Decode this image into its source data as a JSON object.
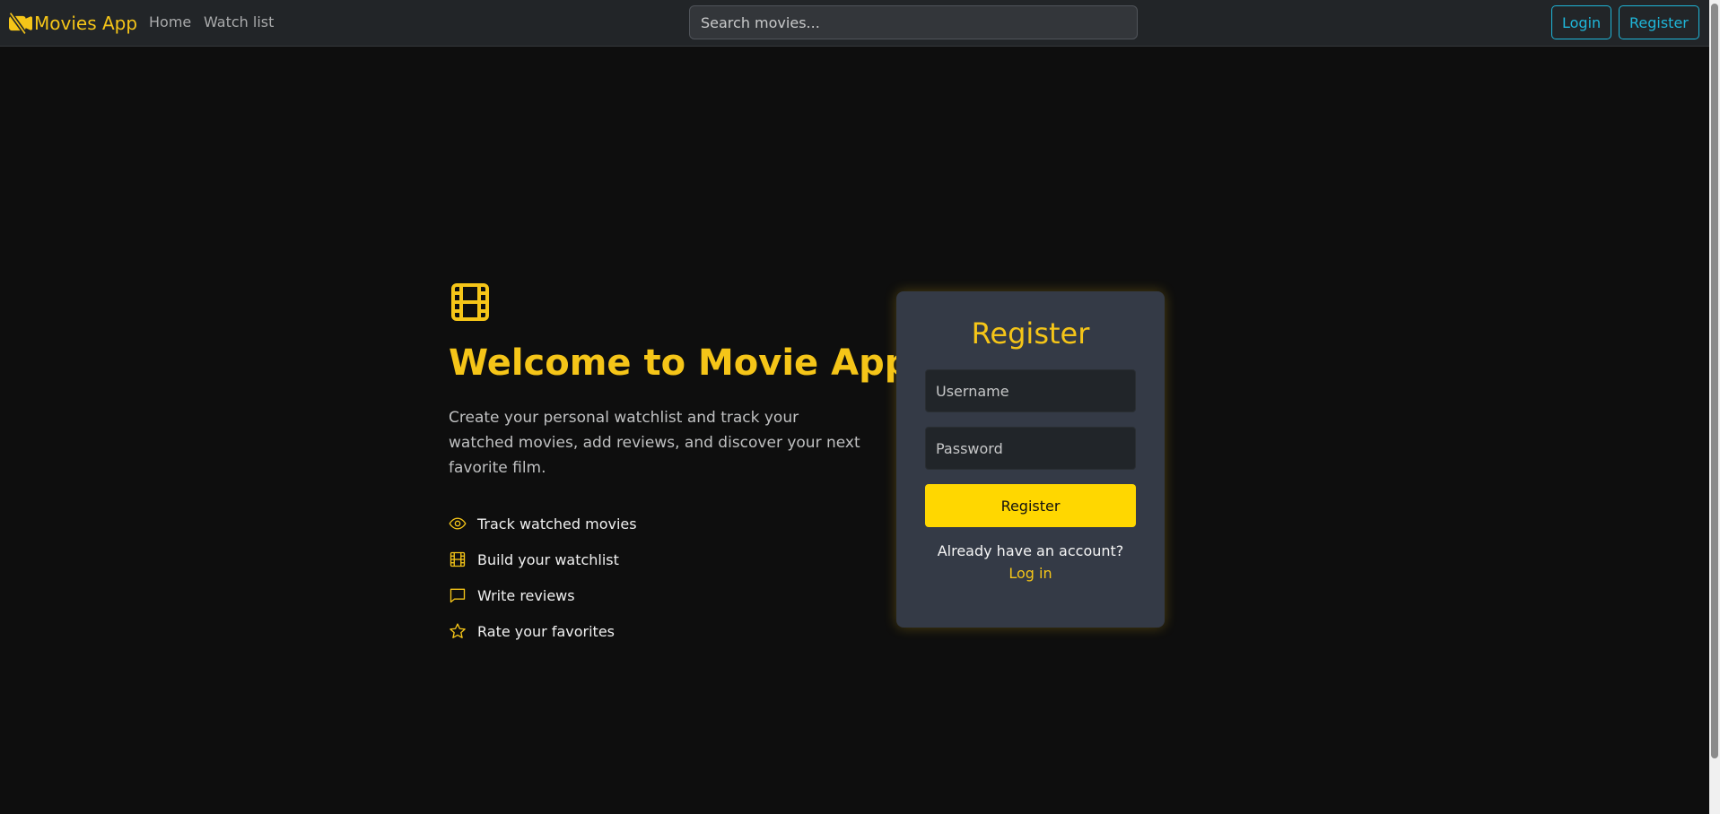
{
  "colors": {
    "accent": "#f5c518",
    "button_yellow": "#ffd700",
    "outline_cyan": "#1fb6d9",
    "navbar_bg": "#222528",
    "page_bg": "#0e0e0e",
    "card_bg": "#343a46"
  },
  "navbar": {
    "brand": "Movies App",
    "brand_icon": "camera-off-icon",
    "links": [
      "Home",
      "Watch list"
    ],
    "search_placeholder": "Search movies...",
    "login_label": "Login",
    "register_label": "Register"
  },
  "hero": {
    "icon": "film-icon",
    "title": "Welcome to Movie App",
    "description": "Create your personal watchlist and track your watched movies, add reviews, and discover your next favorite film.",
    "features": [
      {
        "label": "Track watched movies",
        "icon": "eye-icon"
      },
      {
        "label": "Build your watchlist",
        "icon": "film-icon"
      },
      {
        "label": "Write reviews",
        "icon": "chat-icon"
      },
      {
        "label": "Rate your favorites",
        "icon": "star-icon"
      }
    ]
  },
  "register_form": {
    "title": "Register",
    "username_placeholder": "Username",
    "password_placeholder": "Password",
    "submit_label": "Register",
    "account_prompt": "Already have an account?",
    "login_link": "Log in"
  }
}
